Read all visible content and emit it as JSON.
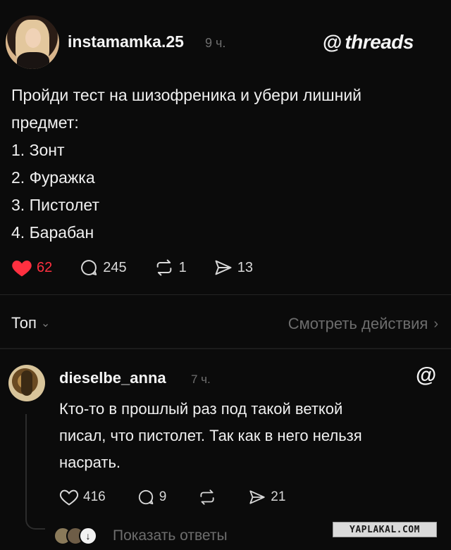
{
  "post": {
    "username": "instamamka.25",
    "time": "9 ч.",
    "brand": {
      "glyph": "@",
      "word": "threads"
    },
    "text_lines": [
      "Пройди тест на шизофреника и убери лишний",
      "предмет:",
      "1. Зонт",
      "2. Фуражка",
      "3. Пистолет",
      "4. Барабан"
    ],
    "actions": {
      "likes": "62",
      "comments": "245",
      "reposts": "1",
      "shares": "13"
    },
    "liked_color": "#ff3040"
  },
  "sort": {
    "label": "Топ",
    "view_activity": "Смотреть действия"
  },
  "reply": {
    "username": "dieselbe_anna",
    "time": "7 ч.",
    "brand_glyph": "@",
    "text_lines": [
      "Кто-то в прошлый раз под такой веткой",
      "писал, что пистолет. Так как в него нельзя",
      "насрать."
    ],
    "actions": {
      "likes": "416",
      "comments": "9",
      "shares": "21"
    },
    "show_replies": "Показать ответы"
  },
  "watermark": "YAPLAKAL.COM"
}
